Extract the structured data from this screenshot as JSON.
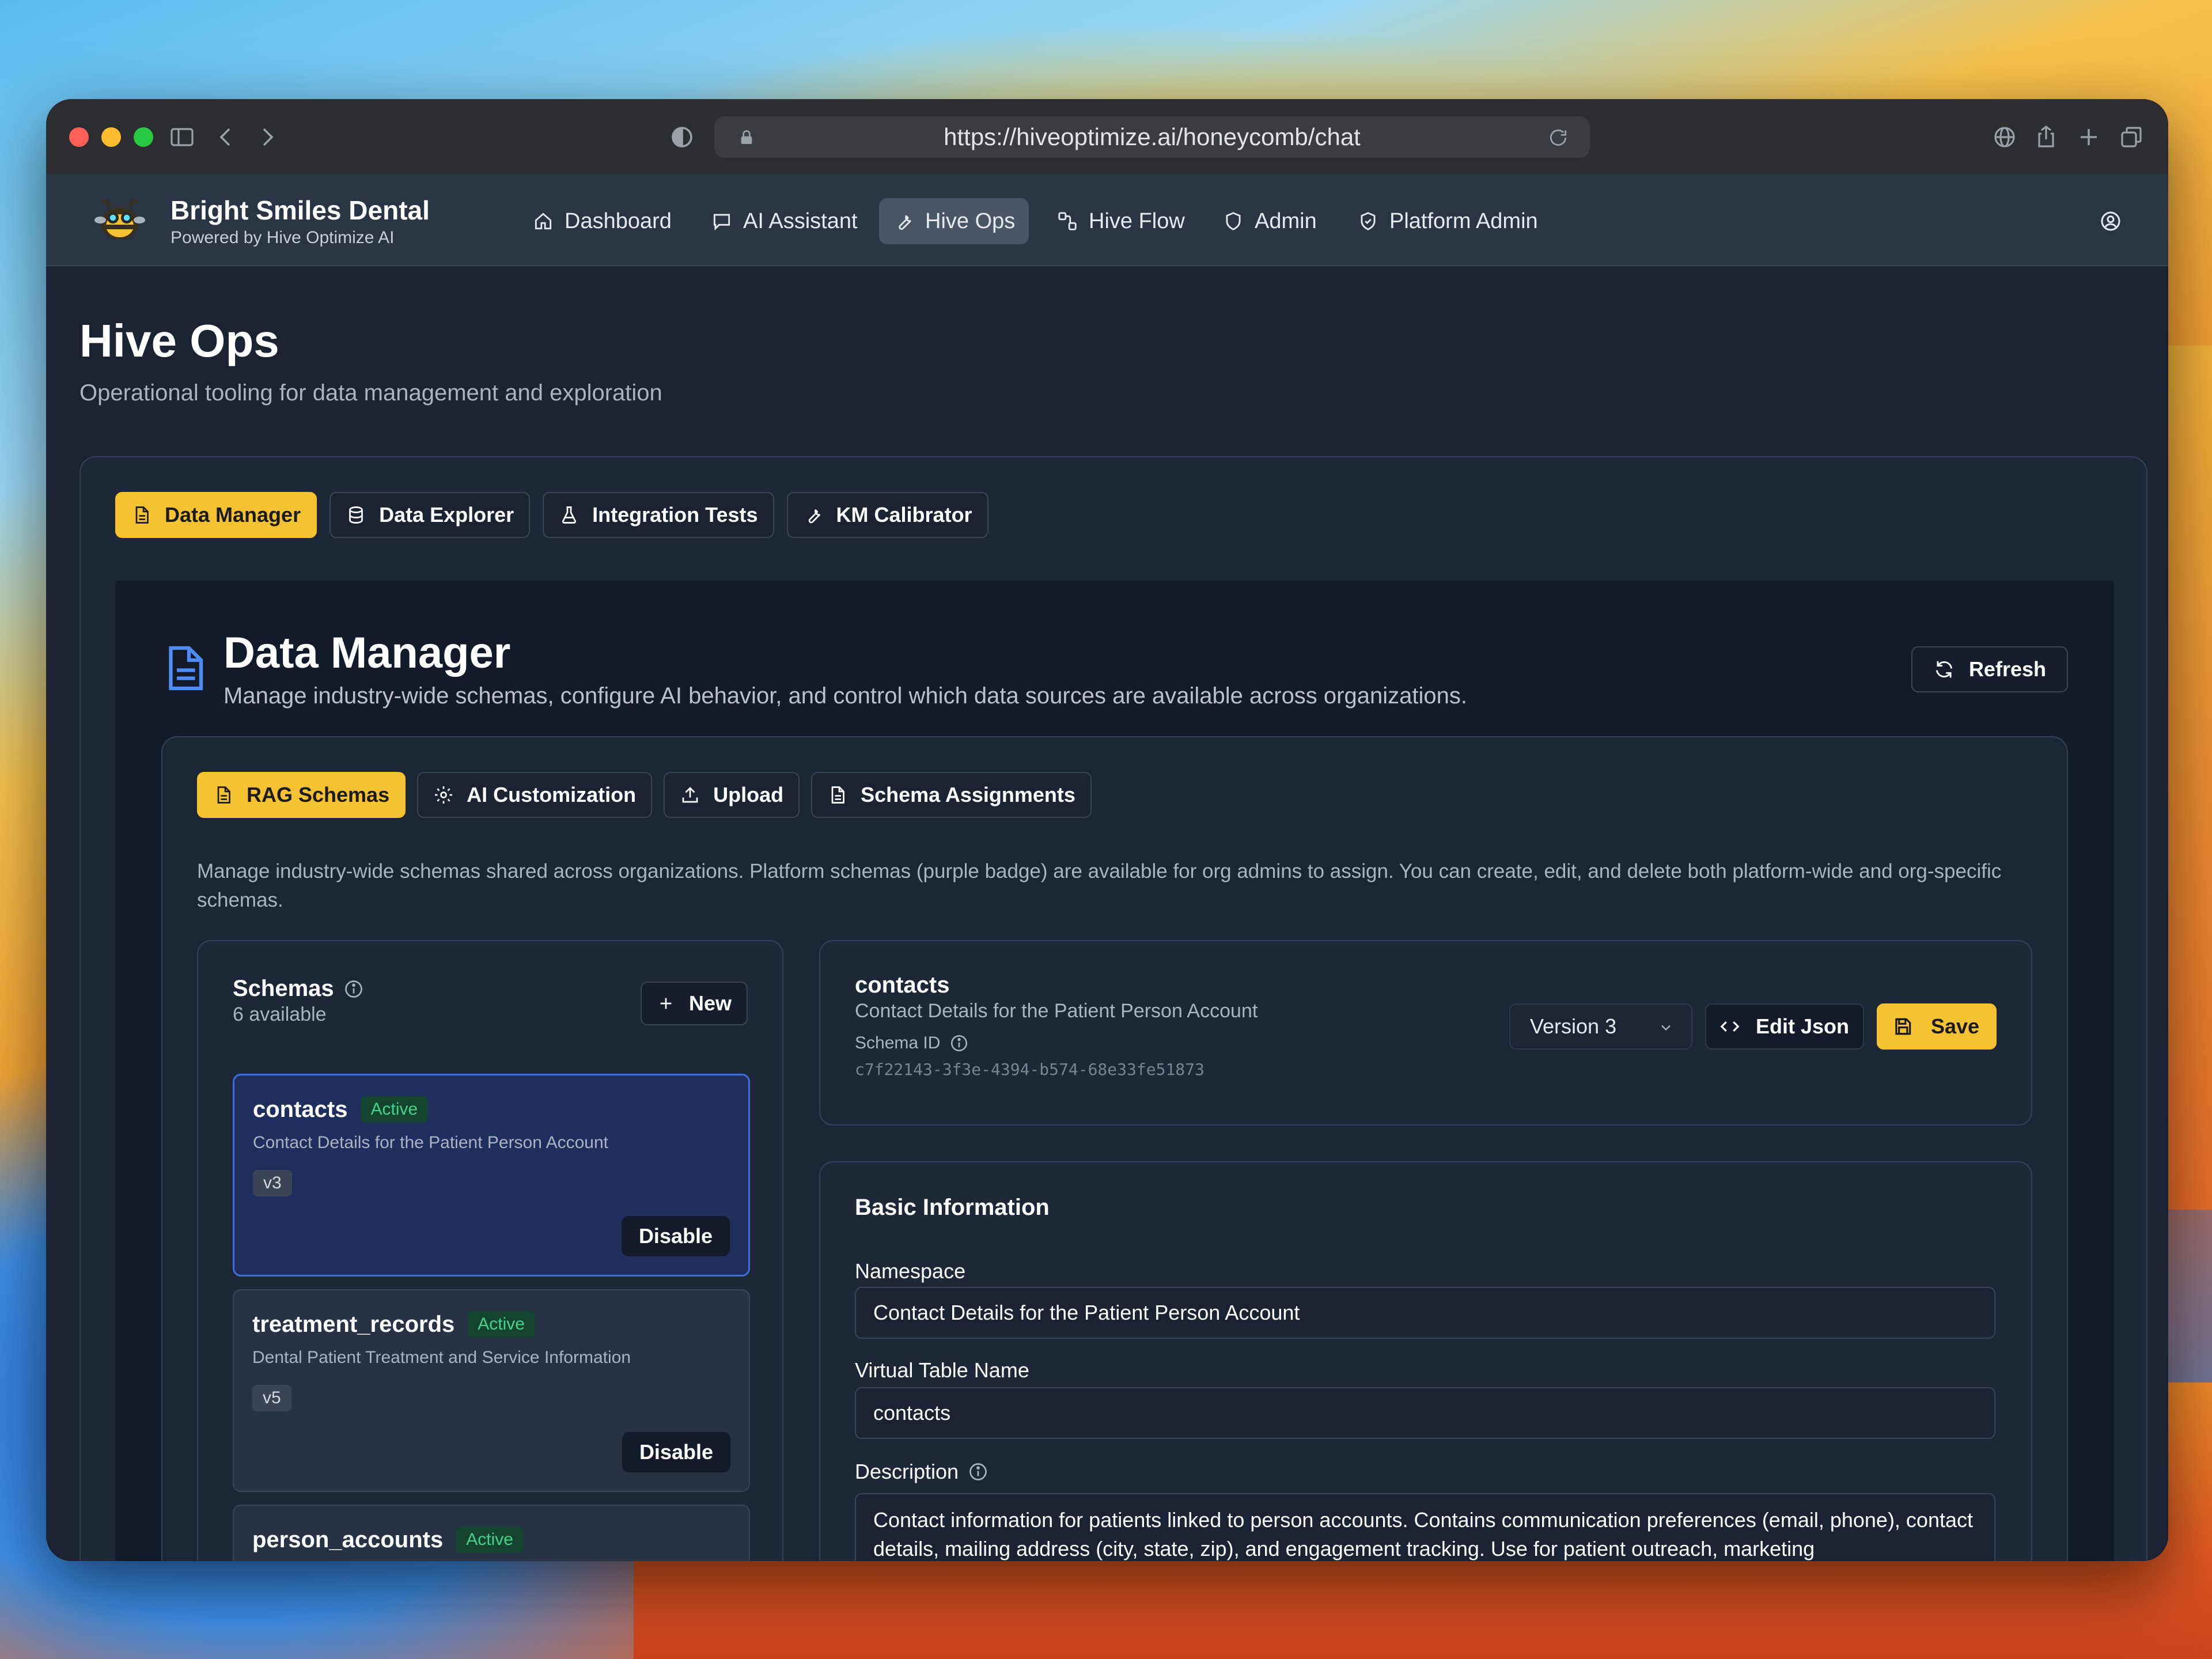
{
  "browser": {
    "url": "https://hiveoptimize.ai/honeycomb/chat"
  },
  "brand": {
    "name": "Bright Smiles Dental",
    "sub": "Powered by Hive Optimize AI"
  },
  "nav": {
    "items": [
      {
        "label": "Dashboard",
        "icon": "home-icon"
      },
      {
        "label": "AI Assistant",
        "icon": "chat-icon"
      },
      {
        "label": "Hive Ops",
        "icon": "wrench-icon"
      },
      {
        "label": "Hive Flow",
        "icon": "flow-icon"
      },
      {
        "label": "Admin",
        "icon": "shield-icon"
      },
      {
        "label": "Platform Admin",
        "icon": "shield-check-icon"
      }
    ],
    "active": "Hive Ops"
  },
  "page": {
    "title": "Hive Ops",
    "subtitle": "Operational tooling for data management and exploration"
  },
  "tabs": [
    {
      "label": "Data Manager",
      "icon": "document-icon",
      "active": true
    },
    {
      "label": "Data Explorer",
      "icon": "database-icon",
      "active": false
    },
    {
      "label": "Integration Tests",
      "icon": "flask-icon",
      "active": false
    },
    {
      "label": "KM Calibrator",
      "icon": "wrench-icon",
      "active": false
    }
  ],
  "data_manager": {
    "title": "Data Manager",
    "subtitle": "Manage industry-wide schemas, configure AI behavior, and control which data sources are available across organizations.",
    "refresh_label": "Refresh",
    "subtabs": [
      {
        "label": "RAG Schemas",
        "icon": "document-icon",
        "active": true
      },
      {
        "label": "AI Customization",
        "icon": "gear-icon",
        "active": false
      },
      {
        "label": "Upload",
        "icon": "upload-icon",
        "active": false
      },
      {
        "label": "Schema Assignments",
        "icon": "document-icon",
        "active": false
      }
    ],
    "help_text": "Manage industry-wide schemas shared across organizations. Platform schemas (purple badge) are available for org admins to assign. You can create, edit, and delete both platform-wide and org-specific schemas."
  },
  "schemas": {
    "title": "Schemas",
    "count": "6 available",
    "new_label": "New",
    "items": [
      {
        "name": "contacts",
        "status": "Active",
        "description": "Contact Details for the Patient Person Account",
        "version": "v3",
        "action": "Disable"
      },
      {
        "name": "treatment_records",
        "status": "Active",
        "description": "Dental Patient Treatment and Service Information",
        "version": "v5",
        "action": "Disable"
      },
      {
        "name": "person_accounts",
        "status": "Active",
        "description": "",
        "version": "",
        "action": ""
      }
    ]
  },
  "detail": {
    "name": "contacts",
    "description": "Contact Details for the Patient Person Account",
    "schema_id_label": "Schema ID",
    "schema_id": "c7f22143-3f3e-4394-b574-68e33fe51873",
    "version": "Version 3",
    "edit_json_label": "Edit Json",
    "save_label": "Save"
  },
  "basic_info": {
    "title": "Basic Information",
    "namespace_label": "Namespace",
    "namespace_value": "Contact Details for the Patient Person Account",
    "vtable_label": "Virtual Table Name",
    "vtable_value": "contacts",
    "description_label": "Description",
    "description_value": "Contact information for patients linked to person accounts. Contains communication preferences (email, phone), contact details, mailing address (city, state, zip), and engagement tracking. Use for patient outreach, marketing"
  },
  "colors": {
    "accent": "#f5c232",
    "selected_border": "#3e6de0",
    "active_badge": "#46d28a",
    "page_bg": "#1b2333"
  }
}
